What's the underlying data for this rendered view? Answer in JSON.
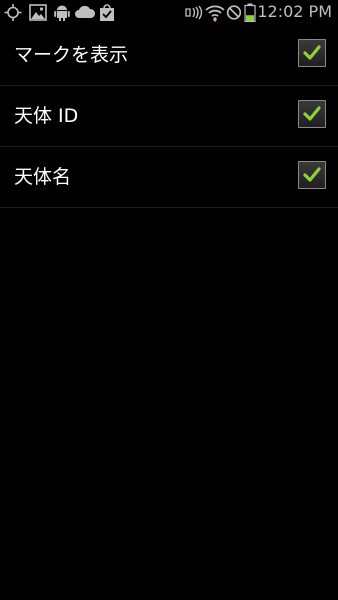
{
  "status_bar": {
    "time": "12:02 PM",
    "left_icons": [
      "gps-icon",
      "gallery-icon",
      "android-icon",
      "cloud-icon",
      "shopping-bag-icon"
    ],
    "right_icons": [
      "nfc-icon",
      "wifi-icon",
      "silent-icon",
      "battery-icon"
    ],
    "battery_level": 0.4
  },
  "settings": {
    "items": [
      {
        "label": "マークを表示",
        "checked": true
      },
      {
        "label": "天体 ID",
        "checked": true
      },
      {
        "label": "天体名",
        "checked": true
      }
    ]
  },
  "colors": {
    "check_accent": "#8fd13a",
    "background": "#000000",
    "battery": "#8fd13a"
  }
}
